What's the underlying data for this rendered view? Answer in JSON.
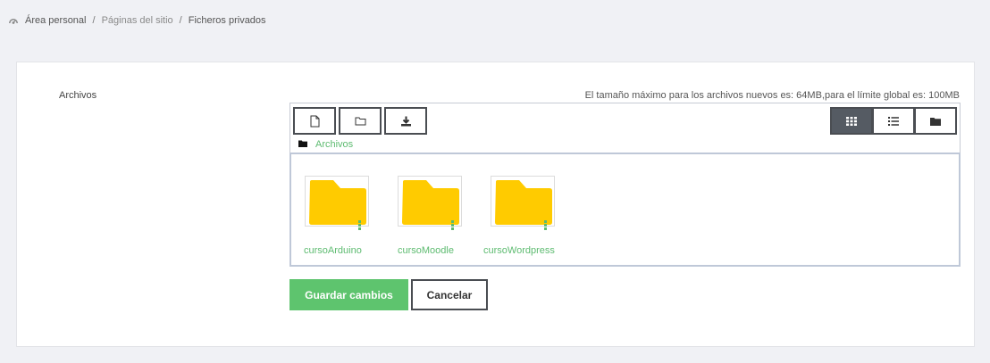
{
  "breadcrumb": {
    "items": [
      "Área personal",
      "Páginas del sitio",
      "Ficheros privados"
    ],
    "separator": "/"
  },
  "form": {
    "field_label": "Archivos",
    "size_info": "El tamaño máximo para los archivos nuevos es: 64MB,para el límite global es: 100MB"
  },
  "filepicker": {
    "toolbar_left": [
      "file-add-icon",
      "folder-add-icon",
      "download-icon"
    ],
    "toolbar_right": [
      "grid-view-icon",
      "list-view-icon",
      "folder-tree-icon"
    ],
    "active_view": "grid-view-icon",
    "path": "Archivos",
    "folders": [
      {
        "name": "cursoArduino"
      },
      {
        "name": "cursoMoodle"
      },
      {
        "name": "cursoWordpress"
      }
    ]
  },
  "buttons": {
    "save": "Guardar cambios",
    "cancel": "Cancelar"
  },
  "colors": {
    "accent_green": "#5ec46e",
    "link_green": "#5dbb70",
    "folder_yellow": "#ffcb00",
    "dark_border": "#4a4d52"
  }
}
